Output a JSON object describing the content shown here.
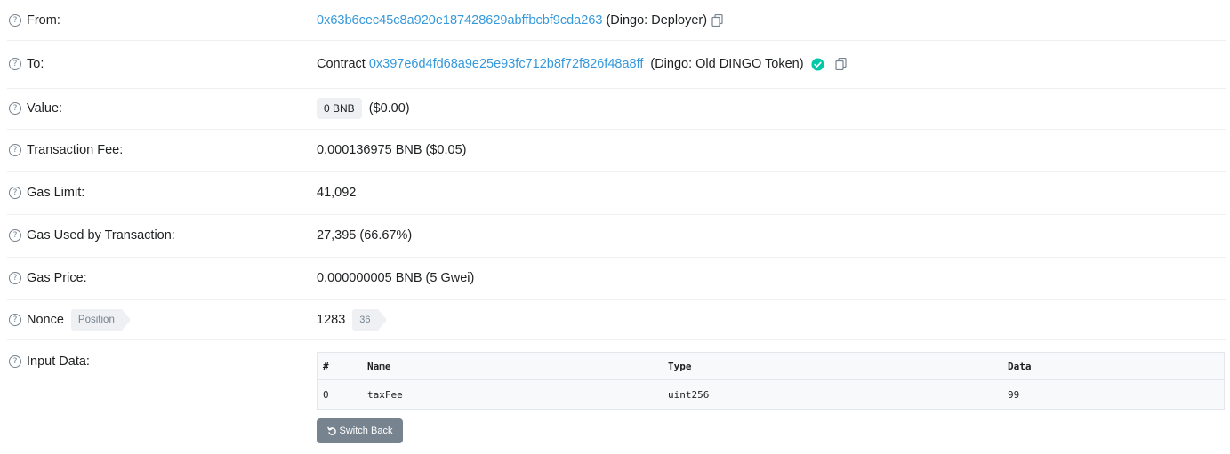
{
  "from": {
    "label": "From:",
    "address": "0x63b6cec45c8a920e187428629abffbcbf9cda263",
    "name": "(Dingo: Deployer)"
  },
  "to": {
    "label": "To:",
    "prefix": "Contract",
    "address": "0x397e6d4fd68a9e25e93fc712b8f72f826f48a8ff",
    "name": "(Dingo: Old DINGO Token)"
  },
  "value": {
    "label": "Value:",
    "badge": "0 BNB",
    "usd": "($0.00)"
  },
  "fee": {
    "label": "Transaction Fee:",
    "text": "0.000136975 BNB ($0.05)"
  },
  "gas_limit": {
    "label": "Gas Limit:",
    "text": "41,092"
  },
  "gas_used": {
    "label": "Gas Used by Transaction:",
    "text": "27,395 (66.67%)"
  },
  "gas_price": {
    "label": "Gas Price:",
    "text": "0.000000005 BNB (5 Gwei)"
  },
  "nonce": {
    "label": "Nonce",
    "position_badge": "Position",
    "value": "1283",
    "position_value": "36"
  },
  "input_data": {
    "label": "Input Data:",
    "headers": [
      "#",
      "Name",
      "Type",
      "Data"
    ],
    "rows": [
      [
        "0",
        "taxFee",
        "uint256",
        "99"
      ]
    ],
    "switch_label": "Switch Back"
  },
  "colors": {
    "link": "#3498db",
    "verified": "#00c9a7",
    "button": "#77838f"
  },
  "icons": {
    "help": "question-circle-icon",
    "copy": "copy-icon",
    "verified": "check-circle-icon",
    "undo": "undo-icon"
  }
}
